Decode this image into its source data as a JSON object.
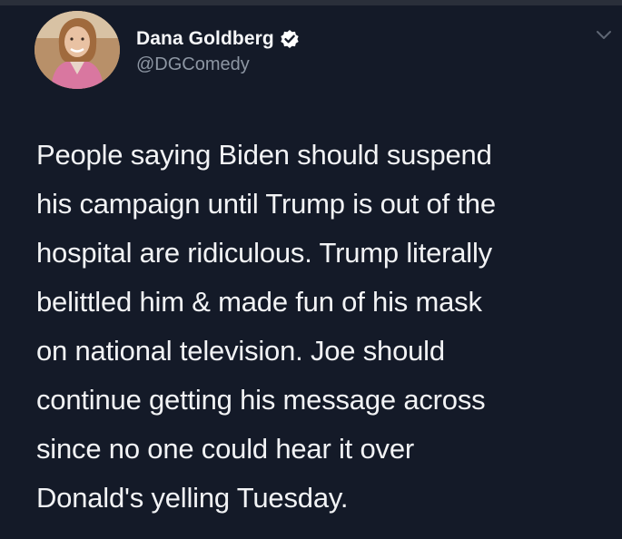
{
  "tweet": {
    "author": {
      "display_name": "Dana Goldberg",
      "handle": "@DGComedy",
      "verified": true
    },
    "text": "People saying Biden should suspend\nhis campaign until Trump is out of the\nhospital are ridiculous. Trump literally\nbelittled him & made fun of his mask\non national television. Joe should\ncontinue getting his message across\nsince no one could hear it over\nDonald's yelling Tuesday."
  },
  "icons": {
    "verified": "verified-badge-icon",
    "more": "chevron-down-icon"
  },
  "colors": {
    "background": "#141a28",
    "text": "#f2f3f5",
    "handle": "#8d96a3",
    "verified_badge": "#ffffff"
  }
}
